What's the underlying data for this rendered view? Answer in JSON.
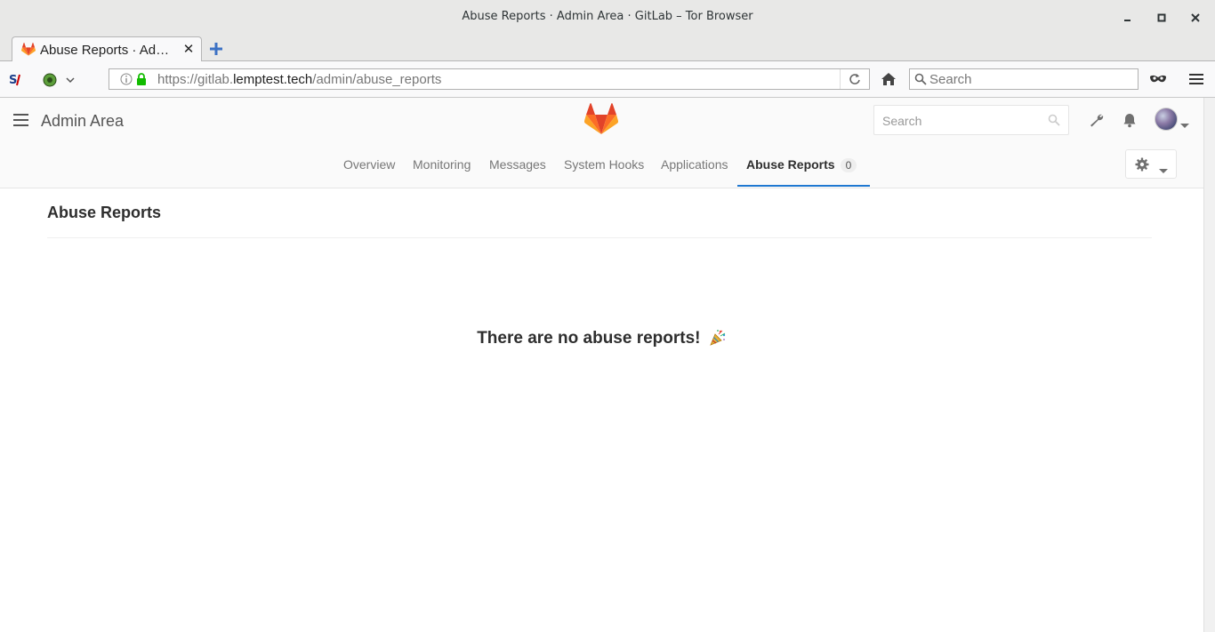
{
  "window": {
    "title": "Abuse Reports · Admin Area · GitLab – Tor Browser"
  },
  "tabs": [
    {
      "title": "Abuse Reports · Ad…",
      "active": true
    }
  ],
  "navbar": {
    "url_prefix": "https://gitlab.",
    "url_host": "lemptest.tech",
    "url_path": "/admin/abuse_reports",
    "search_placeholder": "Search"
  },
  "header": {
    "area_title": "Admin Area",
    "search_placeholder": "Search"
  },
  "subnav": {
    "items": [
      {
        "label": "Overview"
      },
      {
        "label": "Monitoring"
      },
      {
        "label": "Messages"
      },
      {
        "label": "System Hooks"
      },
      {
        "label": "Applications"
      },
      {
        "label": "Abuse Reports",
        "count": "0",
        "active": true
      }
    ]
  },
  "main": {
    "title": "Abuse Reports",
    "empty_message": "There are no abuse reports!"
  },
  "colors": {
    "accent": "#1f78d1",
    "gitlab_orange": "#fc6d26"
  }
}
